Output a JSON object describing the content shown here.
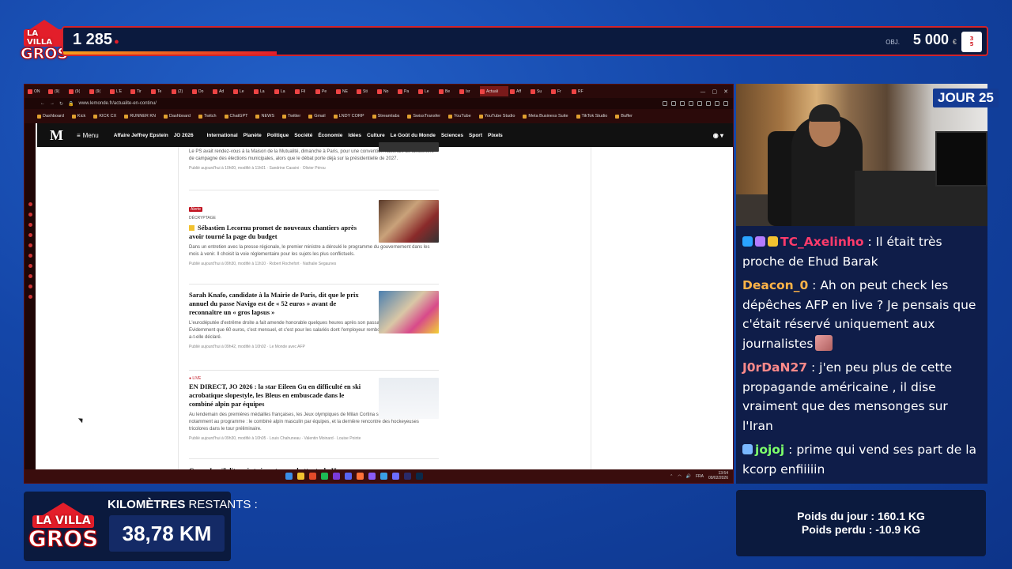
{
  "brand": {
    "logo_line1": "LA VILLA",
    "logo_small": "DES",
    "logo_line2": "GROS"
  },
  "top_bar": {
    "count": "1 285",
    "goal_label": "OBJ.",
    "goal_value": "5 000",
    "goal_unit": "€"
  },
  "browser": {
    "tabs": [
      "ON",
      "(9(",
      "(9(",
      "(9(",
      "L'E",
      "Tir",
      "Te",
      "(2)",
      "Do",
      "Ad",
      "Le",
      "La",
      "La",
      "Fil",
      "Pe",
      "NE",
      "Sti",
      "No",
      "Pa",
      "Le",
      "Be",
      "Isr",
      "Actuali",
      "Aff",
      "Su",
      "Fr",
      "RF"
    ],
    "active_tab": "Actuali",
    "url": "www.lemonde.fr/actualite-en-continu/",
    "bookmarks": [
      "Dashboard",
      "Kick",
      "KICK CX",
      "RUNNER KN",
      "Dashboard",
      "Twitch",
      "ChatGPT",
      "NEWS",
      "Twitter",
      "Gmail",
      "LNDY CORP",
      "Streamlabs",
      "SwissTransfer",
      "YouTube",
      "YouTube Studio",
      "Meta Business Suite",
      "TikTok Studio",
      "Buffer"
    ]
  },
  "lemonde_nav": {
    "logo": "M",
    "menu": "Menu",
    "items": [
      "Affaire Jeffrey Epstein",
      "JO 2026",
      "International",
      "Planète",
      "Politique",
      "Société",
      "Économie",
      "Idées",
      "Culture",
      "Le Goût du Monde",
      "Sciences",
      "Sport",
      "Pixels"
    ]
  },
  "articles": [
    {
      "summary": "Le PS avait rendez-vous à la Maison de la Mutualité, dimanche à Paris, pour une convention nationale de lancement de campagne des élections municipales, alors que le débat porte déjà sur la présidentielle de 2027.",
      "meta": "Publié aujourd'hui à 10h00, modifié à 11h01 · Sandrine Cassini · Olivier Pérou"
    },
    {
      "tag": "Alerte",
      "kicker": "DÉCRYPTAGE",
      "title": "Sébastien Lecornu promet de nouveaux chantiers après avoir tourné la page du budget",
      "summary": "Dans un entretien avec la presse régionale, le premier ministre a déroulé le programme du gouvernement dans les mois à venir. Il choisit la voie réglementaire pour les sujets les plus conflictuels.",
      "meta": "Publié aujourd'hui à 09h30, modifié à 11h10 · Robert Rochefort · Nathalie Segaunes"
    },
    {
      "title": "Sarah Knafo, candidate à la Mairie de Paris, dit que le prix annuel du passe Navigo est de « 52 euros » avant de reconnaître un « gros lapsus »",
      "summary": "L'eurodéputée d'extrême droite a fait amende honorable quelques heures après son passage sur BFM-TV. « Evidemment que 60 euros, c'est mensuel, et c'est pour les salariés dont l'employeur rembourse la moitié du passe », a-t-elle déclaré.",
      "meta": "Publié aujourd'hui à 09h42, modifié à 10h02 · Le Monde avec AFP"
    },
    {
      "live": "● LIVE",
      "title": "EN DIRECT, JO 2026 : la star Eileen Gu en difficulté en ski acrobatique slopestyle, les Bleus en embuscade dans le combiné alpin par équipes",
      "summary": "Au lendemain des premières médailles françaises, les Jeux olympiques de Milan Cortina se poursuivent, lundi, avec notamment au programme : le combiné alpin masculin par équipes, et la dernière rencontre des hockeyeuses tricolores dans le tour préliminaire.",
      "meta": "Publié aujourd'hui à 09h30, modifié à 10h05 · Louis Chahuneau · Valentin Moinard · Louise Pointe"
    },
    {
      "title": "Gaza : Israël dit avoir tué quatre combattants du Hamas"
    }
  ],
  "taskbar": {
    "lang": "FRA",
    "time": "13:54",
    "date": "09/02/2026"
  },
  "stream": {
    "day_badge": "JOUR 25"
  },
  "chat": [
    {
      "user": "TC_Axelinho",
      "color": "#ff3b6b",
      "text": "Il était très proche de Ehud Barak"
    },
    {
      "user": "Deacon_0",
      "color": "#ffb347",
      "text": "Ah on peut check les dépêches AFP en live ? Je pensais que c'était réservé uniquement aux journalistes"
    },
    {
      "user": "J0rDaN27",
      "color": "#ff8a8a",
      "text": "j'en peu plus de cette propagande américaine , il dise vraiment que des mensonges sur l'Iran"
    },
    {
      "user": "jojoj",
      "color": "#7dff6a",
      "text": "prime qui vend ses part de la kcorp enfiiiiin"
    }
  ],
  "km_panel": {
    "title_bold": "KILOMÈTRES",
    "title_rest": "RESTANTS :",
    "value": "38,78 KM"
  },
  "weight_panel": {
    "line1": "Poids du jour : 160.1 KG",
    "line2": "Poids perdu : -10.9 KG"
  },
  "colors": {
    "accent_red": "#d2232a",
    "panel_bg": "#0b1a3e",
    "chat_bg": "#0f1d49"
  }
}
